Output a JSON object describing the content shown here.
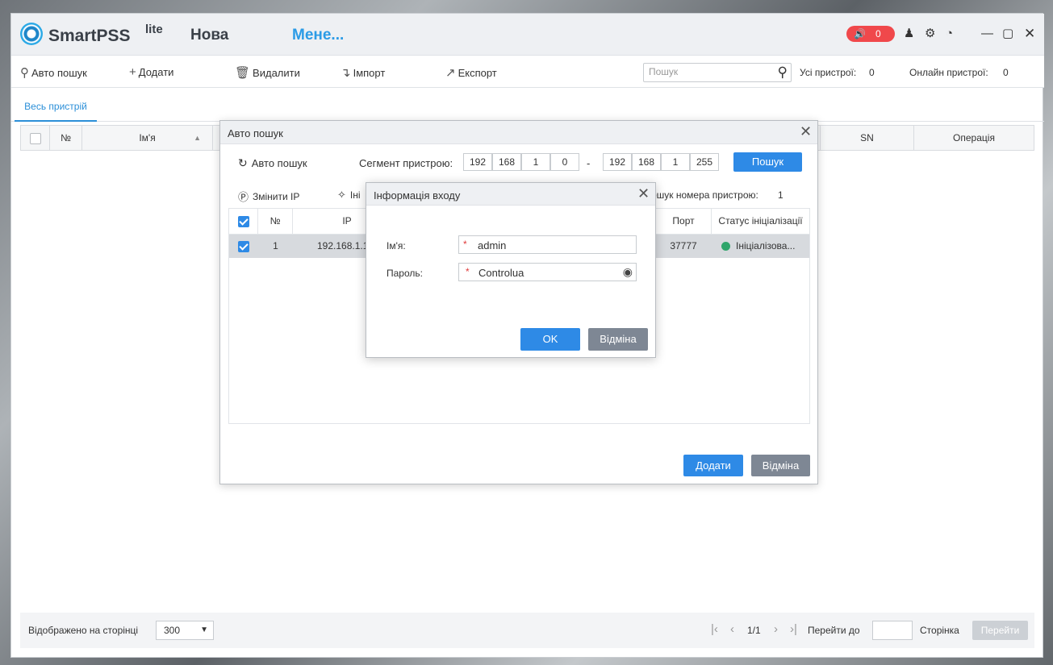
{
  "titlebar": {
    "app_name": "SmartPSS",
    "app_suffix": "lite",
    "tab_new": "Нова",
    "tab_manager": "Мене...",
    "alarm_count": "0"
  },
  "toolbar": {
    "auto_search": "Авто пошук",
    "add": "Додати",
    "delete": "Видалити",
    "import": "Імпорт",
    "export": "Експорт",
    "search_placeholder": "Пошук",
    "all_devices_label": "Усі пристрої:",
    "all_devices_count": "0",
    "online_devices_label": "Онлайн пристрої:",
    "online_devices_count": "0"
  },
  "subtabs": {
    "all_devices": "Весь пристрій"
  },
  "main_table": {
    "columns": {
      "no": "№",
      "name": "Ім'я",
      "sn": "SN",
      "operation": "Операція"
    }
  },
  "footer": {
    "per_page_label": "Відображено на сторінці",
    "per_page_value": "300",
    "page_info": "1/1",
    "goto_label": "Перейти до",
    "page_word": "Сторінка",
    "goto_button": "Перейти"
  },
  "auto_search_dialog": {
    "title": "Авто пошук",
    "auto_search": "Авто пошук",
    "segment_label": "Сегмент пристрою:",
    "ip_from": [
      "192",
      "168",
      "1",
      "0"
    ],
    "ip_to": [
      "192",
      "168",
      "1",
      "255"
    ],
    "dash": "-",
    "search_button": "Пошук",
    "change_ip": "Змінити IP",
    "init_partial": "Іні",
    "search_count_label": "ошук номера пристрою:",
    "search_count": "1",
    "columns": {
      "no": "№",
      "ip": "IP",
      "port": "Порт",
      "init_status": "Статус ініціалізації"
    },
    "rows": [
      {
        "no": "1",
        "ip": "192.168.1.1",
        "port": "37777",
        "status": "Ініціалізова..."
      }
    ],
    "add_button": "Додати",
    "cancel_button": "Відміна"
  },
  "login_dialog": {
    "title": "Інформація входу",
    "username_label": "Ім'я:",
    "username_value": "admin",
    "password_label": "Пароль:",
    "password_value": "Controlua",
    "required_mark": "*",
    "ok_button": "OK",
    "cancel_button": "Відміна"
  }
}
